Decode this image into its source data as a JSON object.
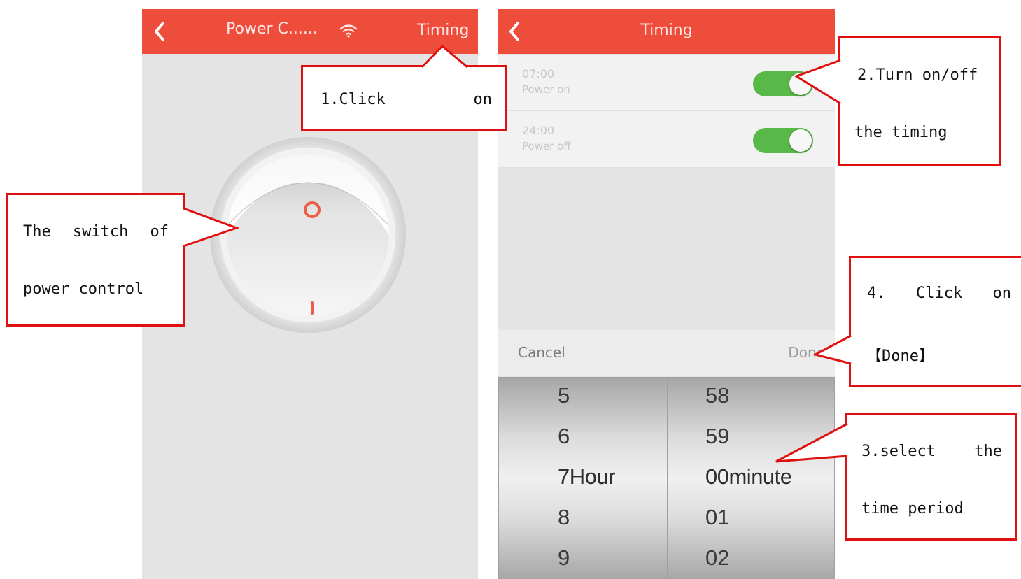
{
  "left_screen": {
    "header": {
      "title": "Power C......",
      "action": "Timing"
    }
  },
  "right_screen": {
    "header": {
      "title": "Timing"
    },
    "timers": [
      {
        "time": "07:00",
        "label": "Power on",
        "enabled": true
      },
      {
        "time": "24:00",
        "label": "Power off",
        "enabled": true
      }
    ],
    "picker": {
      "cancel": "Cancel",
      "done": "Done",
      "hours": [
        "5",
        "6",
        "7",
        "8",
        "9"
      ],
      "minutes": [
        "58",
        "59",
        "00",
        "01",
        "02"
      ],
      "hour_unit": "Hour",
      "minute_unit": "minute"
    }
  },
  "callouts": {
    "c1": {
      "word1": "1.Click",
      "word2": "on"
    },
    "c2": {
      "line1": "2.Turn on/off",
      "line2": "the timing"
    },
    "c3": {
      "line1_a": "3.select",
      "line1_b": "the",
      "line2": "time period"
    },
    "c4": {
      "line1_a": "4.",
      "line1_b": "Click",
      "line1_c": "on",
      "line2": "【Done】"
    },
    "switch": {
      "line1_a": "The",
      "line1_b": "switch",
      "line1_c": "of",
      "line2": "power control"
    }
  },
  "colors": {
    "header": "#ee4d3c",
    "toggle_on": "#58b848",
    "callout_border": "#e01010"
  },
  "icons": {
    "back": "chevron-left-icon",
    "wifi": "wifi-icon"
  }
}
